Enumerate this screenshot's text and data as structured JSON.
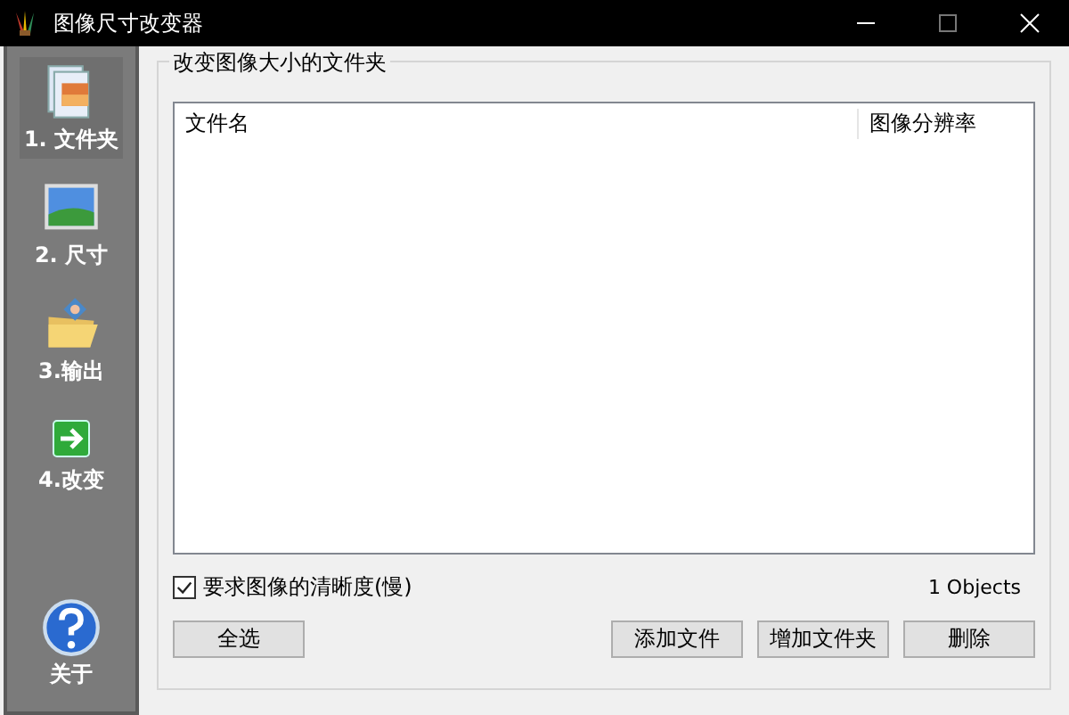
{
  "window": {
    "title": "图像尺寸改变器"
  },
  "sidebar": {
    "items": [
      {
        "label": "1. 文件夹",
        "kind": "folder",
        "selected": true
      },
      {
        "label": "2. 尺寸",
        "kind": "size",
        "selected": false
      },
      {
        "label": "3.输出",
        "kind": "output",
        "selected": false
      },
      {
        "label": "4.改变",
        "kind": "change",
        "selected": false
      }
    ],
    "help": {
      "label": "关于"
    }
  },
  "group": {
    "title": "改变图像大小的文件夹"
  },
  "table": {
    "columns": [
      "文件名",
      "图像分辨率"
    ]
  },
  "sharpness": {
    "label": "要求图像的清晰度(慢)",
    "checked": true
  },
  "count": "1 Objects",
  "buttons": {
    "left": "全选",
    "right": [
      "添加文件",
      "增加文件夹",
      "删除"
    ]
  }
}
